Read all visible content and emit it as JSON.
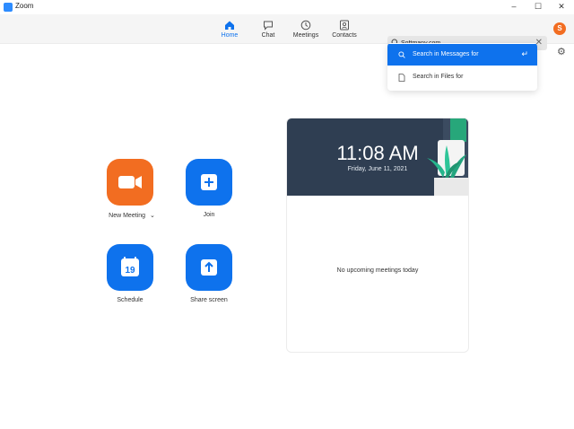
{
  "window": {
    "title": "Zoom",
    "min": "–",
    "max": "☐",
    "close": "✕"
  },
  "nav": [
    {
      "label": "Home",
      "icon": "home-icon",
      "active": true
    },
    {
      "label": "Chat",
      "icon": "chat-icon"
    },
    {
      "label": "Meetings",
      "icon": "clock-icon"
    },
    {
      "label": "Contacts",
      "icon": "contacts-icon"
    }
  ],
  "search": {
    "value": "Softmany.com",
    "clear": "✕"
  },
  "dropdown": {
    "messages_label": "Search in Messages for",
    "files_label": "Search in Files for",
    "enter": "↵"
  },
  "avatar": {
    "initial": "S",
    "color": "#f26d21"
  },
  "settings": {
    "glyph": "⚙"
  },
  "actions": {
    "new_meeting": {
      "label": "New Meeting",
      "chevron": "⌄",
      "color": "#f26d21"
    },
    "join": {
      "label": "Join",
      "color": "#0e72ed"
    },
    "schedule": {
      "label": "Schedule",
      "day": "19",
      "color": "#0e72ed"
    },
    "share": {
      "label": "Share screen",
      "color": "#0e72ed"
    }
  },
  "calendar": {
    "time": "11:08 AM",
    "date": "Friday, June 11, 2021",
    "empty": "No upcoming meetings today"
  },
  "colors": {
    "accent": "#0e72ed",
    "header_bg": "#2f3e52"
  }
}
